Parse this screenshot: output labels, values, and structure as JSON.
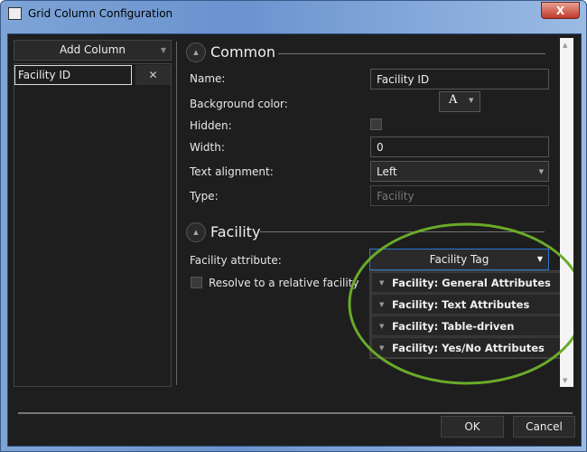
{
  "window": {
    "title": "Grid Column Configuration",
    "close_label": "X"
  },
  "left": {
    "add_column": "Add Column",
    "columns": [
      {
        "name": "Facility ID"
      }
    ],
    "remove_label": "✕"
  },
  "common": {
    "header": "Common",
    "name_label": "Name:",
    "name_value": "Facility ID",
    "bg_label": "Background color:",
    "bg_glyph": "A",
    "hidden_label": "Hidden:",
    "hidden_checked": false,
    "width_label": "Width:",
    "width_value": "0",
    "align_label": "Text alignment:",
    "align_value": "Left",
    "type_label": "Type:",
    "type_value": "Facility"
  },
  "facility": {
    "header": "Facility",
    "attr_label": "Facility attribute:",
    "attr_value": "Facility Tag",
    "resolve_label": "Resolve to a relative facility",
    "resolve_checked": false,
    "options": [
      "Facility: General Attributes",
      "Facility: Text Attributes",
      "Facility: Table-driven Attributes",
      "Facility: Yes/No Attributes"
    ]
  },
  "footer": {
    "ok": "OK",
    "cancel": "Cancel"
  },
  "colors": {
    "annotation": "#6aaa2a",
    "focus": "#2a7ad0"
  }
}
